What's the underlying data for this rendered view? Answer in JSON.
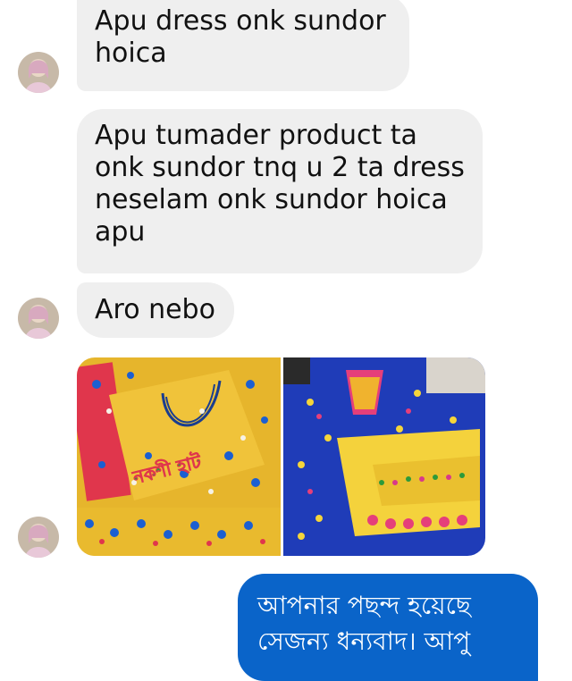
{
  "conversation": {
    "messages": [
      {
        "sender": "contact",
        "text": "Apu dress onk sundor\nhoica"
      },
      {
        "sender": "contact",
        "text": "Apu tumader product ta\nonk sundor tnq u 2 ta dress\nneselam onk sundor hoica\napu"
      },
      {
        "sender": "contact",
        "text": "Aro nebo"
      },
      {
        "sender": "contact",
        "type": "photos",
        "count": 2,
        "watermark_text": "নকশী হাট"
      },
      {
        "sender": "me",
        "text": "আপনার পছন্দ হয়েছে\nসেজন্য ধন্যবাদ। আপু"
      }
    ]
  },
  "colors": {
    "incoming_bubble": "#efefef",
    "outgoing_bubble": "#0a64c9",
    "incoming_text": "#111111",
    "outgoing_text": "#ffffff"
  },
  "icons": {
    "avatar": "contact-avatar-icon"
  }
}
